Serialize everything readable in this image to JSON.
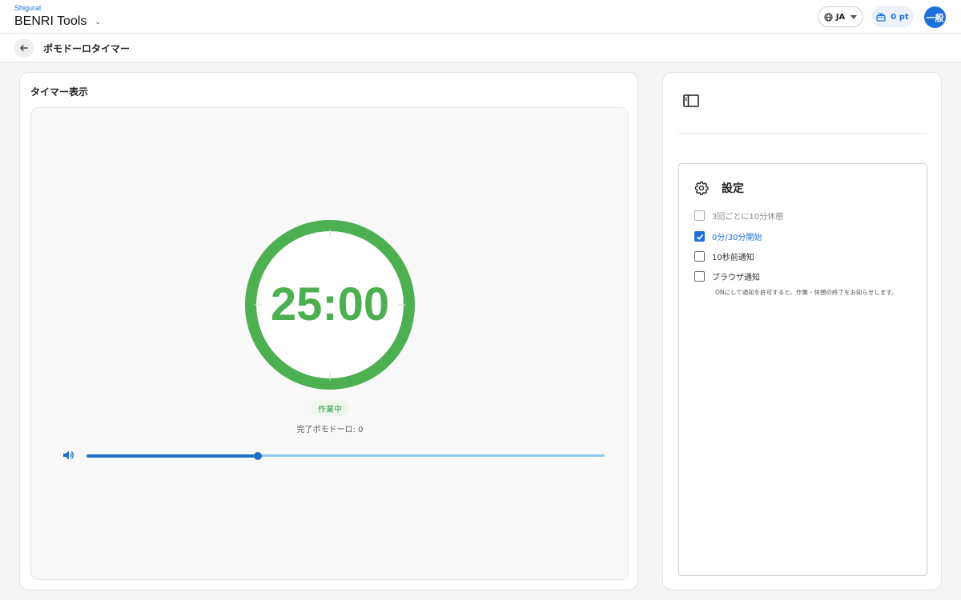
{
  "app": {
    "brand_small": "Shigural",
    "brand_name": "BENRI Tools"
  },
  "header": {
    "language": "JA",
    "points": "0 pt",
    "user_badge": "一般"
  },
  "page": {
    "title": "ポモドーロタイマー"
  },
  "timer": {
    "card_title": "タイマー表示",
    "time": "25:00",
    "progress": 1.0,
    "status": "作業中",
    "completed_label": "完了ポモドーロ: 0",
    "volume": 0.33,
    "ring_color": "#4caf50"
  },
  "settings": {
    "title": "設定",
    "options": [
      {
        "label": "3回ごとに10分休憩",
        "checked": false,
        "disabled": true
      },
      {
        "label": "0分/30分開始",
        "checked": true,
        "disabled": false
      },
      {
        "label": "10秒前通知",
        "checked": false,
        "disabled": false
      },
      {
        "label": "ブラウザ通知",
        "checked": false,
        "disabled": false
      }
    ],
    "hint": "ONにして通知を許可すると、作業・休憩の終了をお知らせします。"
  },
  "colors": {
    "accent": "#1e6fd9",
    "timer_green": "#4caf50"
  },
  "icons": {
    "language": "globe-icon",
    "points": "gift-icon",
    "back": "arrow-left-icon",
    "volume": "volume-icon",
    "sidebar": "sidebar-panel-icon",
    "settings": "gear-icon"
  }
}
